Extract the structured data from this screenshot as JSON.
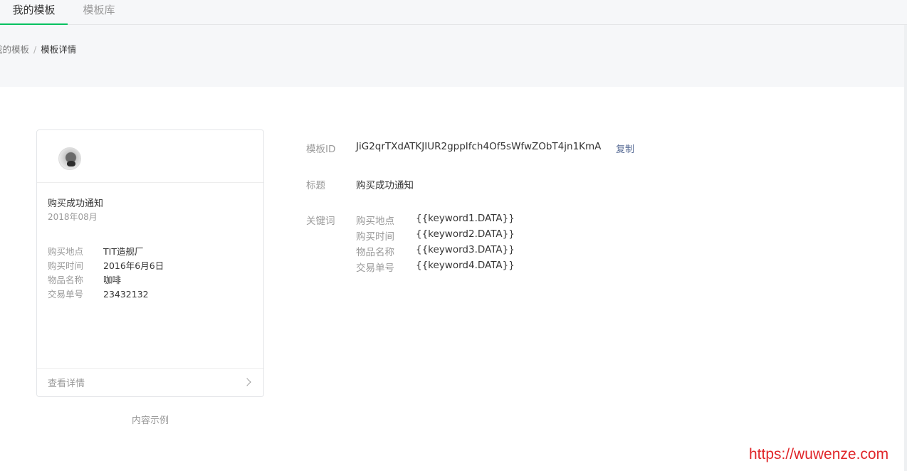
{
  "tabs": [
    {
      "label": "我的模板",
      "active": true
    },
    {
      "label": "模板库",
      "active": false
    }
  ],
  "breadcrumb": {
    "parent": "我的模板",
    "separator": "/",
    "current": "模板详情"
  },
  "preview": {
    "title": "购买成功通知",
    "date": "2018年08月",
    "fields": [
      {
        "label": "购买地点",
        "value": "TIT造舰厂"
      },
      {
        "label": "购买时间",
        "value": "2016年6月6日"
      },
      {
        "label": "物品名称",
        "value": "咖啡"
      },
      {
        "label": "交易单号",
        "value": "23432132"
      }
    ],
    "footer_label": "查看详情",
    "caption": "内容示例"
  },
  "details": {
    "template_id_label": "模板ID",
    "template_id": "JiG2qrTXdATKJIUR2gppIfch4Of5sWfwZObT4jn1KmA",
    "copy_label": "复制",
    "title_label": "标题",
    "title": "购买成功通知",
    "keywords_label": "关键词",
    "keywords": [
      {
        "name": "购买地点",
        "value": "{{keyword1.DATA}}"
      },
      {
        "name": "购买时间",
        "value": "{{keyword2.DATA}}"
      },
      {
        "name": "物品名称",
        "value": "{{keyword3.DATA}}"
      },
      {
        "name": "交易单号",
        "value": "{{keyword4.DATA}}"
      }
    ]
  },
  "watermark": "https://wuwenze.com",
  "colors": {
    "accent": "#07c160",
    "link": "#576b95",
    "watermark": "#e0262a"
  }
}
